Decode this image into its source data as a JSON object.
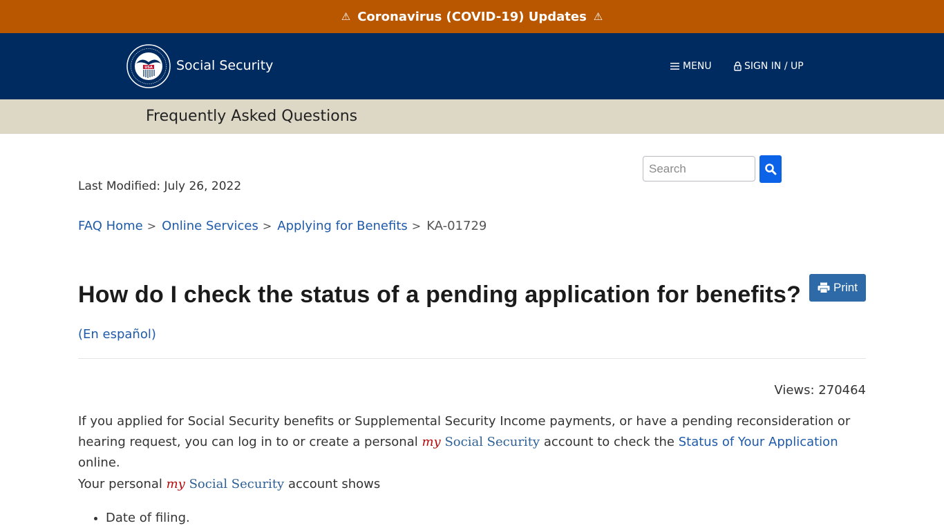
{
  "alert": {
    "text": "Coronavirus (COVID-19) Updates",
    "icon": "warning-icon",
    "background": "#b95600"
  },
  "header": {
    "brand": "Social Security",
    "logo": "ssa-seal-logo",
    "menu_label": "MENU",
    "signin_label": "SIGN IN / UP",
    "background": "#002b60"
  },
  "subheader": {
    "title": "Frequently Asked Questions"
  },
  "search": {
    "placeholder": "Search",
    "value": ""
  },
  "meta": {
    "last_modified": "Last Modified: July 26, 2022",
    "views": "Views: 270464"
  },
  "breadcrumb": {
    "items": [
      "FAQ Home",
      "Online Services",
      "Applying for Benefits"
    ],
    "separator": ">",
    "current": "KA-01729"
  },
  "article": {
    "title": "How do I check the status of a pending application for benefits?",
    "print_label": "Print",
    "espanol_link": "(En español)",
    "para1": {
      "text_a": "If you applied for Social Security benefits or Supplemental Security Income payments, or have a pending reconsideration or hearing request, you can log in to or create a personal ",
      "my": "my",
      "ssa": " Social Security",
      "text_b": " account to check the ",
      "link": "Status of Your Application",
      "text_c": " online."
    },
    "para2": {
      "text_a": "Your personal ",
      "my": "my",
      "ssa": " Social Security",
      "text_b": " account shows"
    },
    "bullets": [
      "Date of filing."
    ]
  },
  "colors": {
    "link": "#1e5aa8",
    "my_red": "#b50909",
    "search_button": "#0d63e8",
    "print_button": "#2e6aa7",
    "subheader_bg": "#ddd8c6"
  }
}
